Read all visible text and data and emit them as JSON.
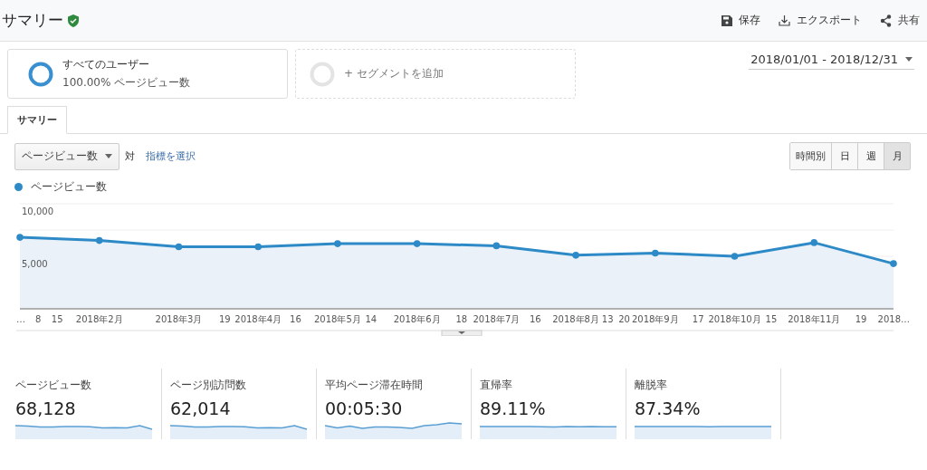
{
  "header": {
    "title": "サマリー",
    "actions": [
      {
        "kind": "save",
        "label": "保存"
      },
      {
        "kind": "export",
        "label": "エクスポート"
      },
      {
        "kind": "share",
        "label": "共有"
      }
    ]
  },
  "segments": [
    {
      "kind": "active",
      "name": "すべてのユーザー",
      "detail": "100.00% ページビュー数"
    },
    {
      "kind": "add",
      "name": "+ セグメントを追加"
    }
  ],
  "date_range": "2018/01/01 - 2018/12/31",
  "tabs": [
    {
      "label": "サマリー",
      "selected": true
    }
  ],
  "metric_select": {
    "value": "ページビュー数",
    "versus": "対",
    "link": "指標を選択"
  },
  "intervals": [
    {
      "label": "時間別",
      "selected": false
    },
    {
      "label": "日",
      "selected": false
    },
    {
      "label": "週",
      "selected": false
    },
    {
      "label": "月",
      "selected": true
    }
  ],
  "chart_data": {
    "type": "area",
    "categories": [
      "…",
      "8",
      "15",
      "2018年2月",
      "2018年3月",
      "19",
      "2018年4月",
      "16",
      "2018年5月",
      "14",
      "2018年6月",
      "18",
      "2018年7月",
      "16",
      "2018年8月",
      "13",
      "20",
      "2018年9月",
      "17",
      "2018年10月",
      "15",
      "2018年11月",
      "19",
      "2018…"
    ],
    "series": [
      {
        "name": "ページビュー数",
        "color": "#2d8ac7",
        "values": [
          6800,
          null,
          null,
          6500,
          5900,
          null,
          5900,
          null,
          6200,
          null,
          6200,
          null,
          6000,
          null,
          5100,
          null,
          null,
          5300,
          null,
          5000,
          null,
          6300,
          null,
          4300
        ]
      }
    ],
    "ylim": [
      0,
      10000
    ],
    "yticks": [
      {
        "value": 5000,
        "label": "5,000"
      },
      {
        "value": 10000,
        "label": "10,000"
      }
    ]
  },
  "metrics": [
    {
      "label": "ページビュー数",
      "value": "68,128"
    },
    {
      "label": "ページ別訪問数",
      "value": "62,014"
    },
    {
      "label": "平均ページ滞在時間",
      "value": "00:05:30"
    },
    {
      "label": "直帰率",
      "value": "89.11%"
    },
    {
      "label": "離脱率",
      "value": "87.34%"
    }
  ]
}
